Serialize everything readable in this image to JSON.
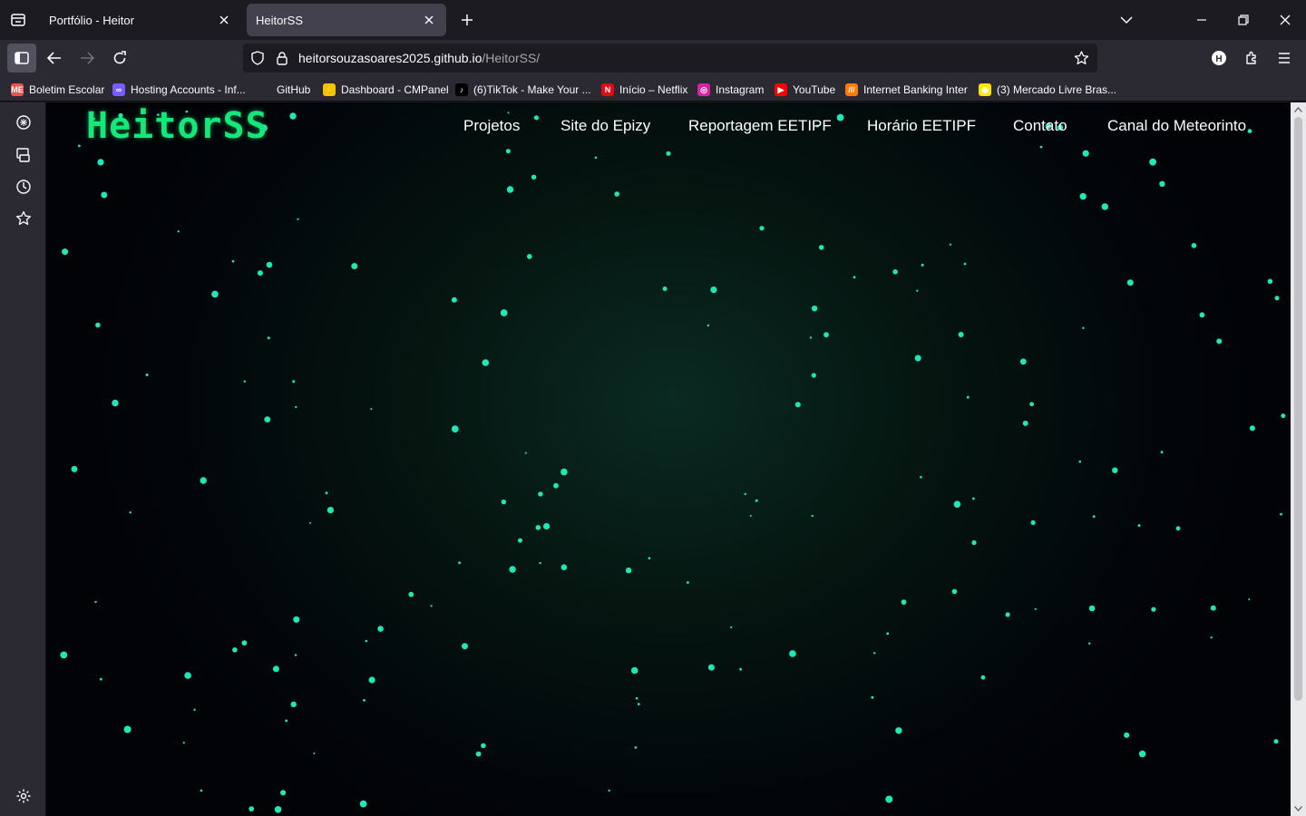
{
  "browser": {
    "tabs": [
      {
        "title": "Portfólio - Heitor",
        "active": false
      },
      {
        "title": "HeitorSS",
        "active": true
      }
    ],
    "url": {
      "host": "heitorsouzasoares2025.github.io",
      "path": "/HeitorSS/"
    },
    "bookmarks": [
      {
        "label": "Boletim Escolar",
        "icon": "boletim-favicon",
        "color": "#e8554f",
        "glyph": "ME"
      },
      {
        "label": "Hosting Accounts - Inf...",
        "icon": "infinity-favicon",
        "color": "#7b5cff",
        "glyph": "∞"
      },
      {
        "label": "GitHub",
        "icon": "github-favicon",
        "color": "#2b2a33",
        "glyph": ""
      },
      {
        "label": "Dashboard - CMPanel",
        "icon": "bolt-favicon",
        "color": "#f5c400",
        "glyph": "⚡"
      },
      {
        "label": "(6)TikTok - Make Your ...",
        "icon": "tiktok-favicon",
        "color": "#000000",
        "glyph": "♪"
      },
      {
        "label": "Início – Netflix",
        "icon": "netflix-favicon",
        "color": "#e50914",
        "glyph": "N"
      },
      {
        "label": "Instagram",
        "icon": "instagram-favicon",
        "color": "#d6249f",
        "glyph": "◎"
      },
      {
        "label": "YouTube",
        "icon": "youtube-favicon",
        "color": "#ff0000",
        "glyph": "▶"
      },
      {
        "label": "Internet Banking Inter",
        "icon": "inter-favicon",
        "color": "#ff7a00",
        "glyph": "///"
      },
      {
        "label": "(3) Mercado Livre Bras...",
        "icon": "mercadolivre-favicon",
        "color": "#ffe600",
        "glyph": "◉"
      }
    ]
  },
  "site": {
    "logo": "HeitorSS",
    "nav": [
      "Projetos",
      "Site do Epizy",
      "Reportagem EETIPF",
      "Horário EETIPF",
      "Contato",
      "Canal do Meteorinto"
    ],
    "accent_color": "#14e87a",
    "particle_color": "#1de9b6"
  }
}
